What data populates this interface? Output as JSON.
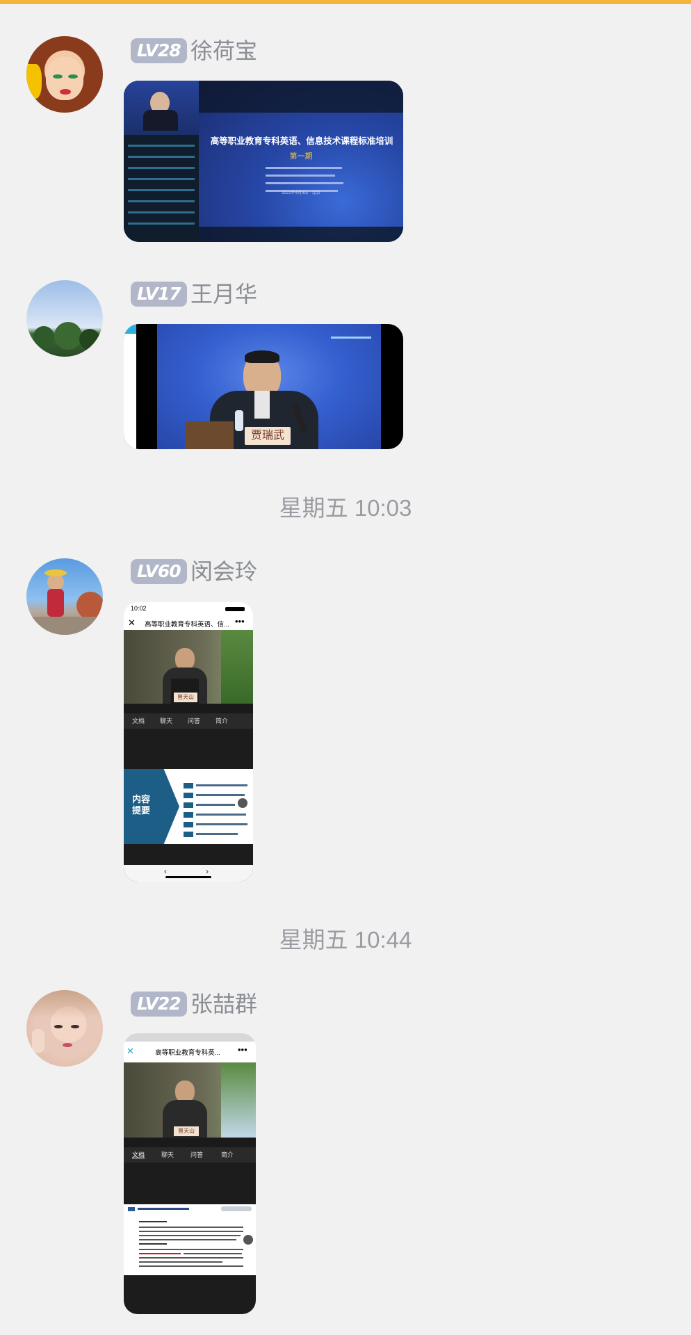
{
  "messages": [
    {
      "level": "LV28",
      "name": "徐荷宝",
      "slide": {
        "title": "高等职业教育专科英语、信息技术课程标准培训",
        "subtitle": "第一期",
        "date": "2021年4月9日 · 北京"
      }
    },
    {
      "level": "LV17",
      "name": "王月华",
      "nameplate": "贾瑞武"
    },
    {
      "level": "LV60",
      "name": "闵会玲",
      "phone": {
        "time": "10:02",
        "title": "高等职业教育专科英语、信...",
        "nameplate": "曾天山",
        "tabs": [
          "文档",
          "聊天",
          "问答",
          "简介"
        ],
        "panel_title": "内容\n提要"
      }
    },
    {
      "level": "LV22",
      "name": "张喆群",
      "phone": {
        "title": "高等职业教育专科英...",
        "nameplate": "曾天山",
        "tabs": [
          "文档",
          "聊天",
          "问答",
          "简介"
        ]
      }
    }
  ],
  "timestamps": [
    "星期五 10:03",
    "星期五 10:44"
  ],
  "colors": {
    "accent_bar": "#f5b43d",
    "level_badge": "#b1b7c9"
  }
}
